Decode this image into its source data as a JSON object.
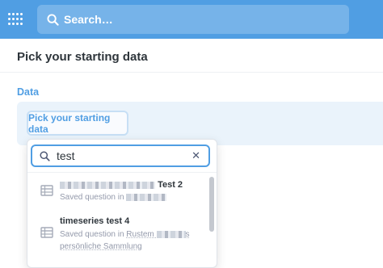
{
  "topbar": {
    "logo_icon": "metabase-logo-icon",
    "search_icon": "search-icon",
    "search_placeholder": "Search…",
    "bg_color": "#509ee3"
  },
  "page": {
    "title": "Pick your starting data"
  },
  "data_section": {
    "label": "Data",
    "pick_button_label": "Pick your starting data",
    "accent_color": "#509ee3"
  },
  "picker": {
    "search_value": "test",
    "clear_icon": "close-icon",
    "results": [
      {
        "icon": "table-icon",
        "title": "Test 2",
        "meta_prefix": "Saved question in",
        "meta_link": ""
      },
      {
        "icon": "table-icon",
        "title": "timeseries test 4",
        "meta_prefix": "Saved question in",
        "meta_link": "Rustem",
        "meta_link_end": "s",
        "meta_line2": "persönliche Sammlung"
      }
    ]
  }
}
